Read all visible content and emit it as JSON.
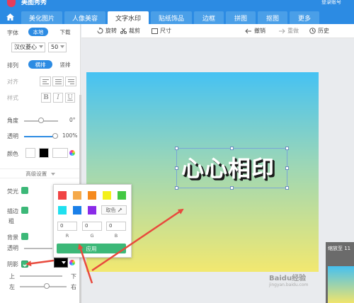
{
  "app": {
    "title": "美图秀秀",
    "login": "登录账号"
  },
  "tabs": [
    {
      "label": "美化图片"
    },
    {
      "label": "人像美容"
    },
    {
      "label": "文字水印"
    },
    {
      "label": "贴纸饰品"
    },
    {
      "label": "边框"
    },
    {
      "label": "拼图"
    },
    {
      "label": "抠图"
    },
    {
      "label": "更多"
    }
  ],
  "toolbar": {
    "rotate": "旋转",
    "crop": "裁剪",
    "size": "尺寸",
    "undo": "撤销",
    "redo": "重做",
    "history": "历史"
  },
  "left_panel": {
    "font_label": "字体",
    "font_local": "本地",
    "font_download": "下载",
    "font_name": "汉仪菱心",
    "font_size": "50",
    "layout_label": "排列",
    "layout_horizontal": "横排",
    "layout_vertical": "竖排",
    "align_label": "对齐",
    "style_label": "样式",
    "style_b": "B",
    "style_i": "I",
    "style_u": "U",
    "angle_label": "角度",
    "angle_value": "0°",
    "opacity_label": "透明",
    "opacity_value": "100%",
    "color_label": "颜色",
    "advanced": "高级设置",
    "glow_label": "荧光",
    "stroke_label": "描边",
    "stroke_thick": "粗",
    "bg_label": "背景",
    "bg_opacity": "透明",
    "shadow_label": "阴影",
    "shadow_top": "上",
    "shadow_bottom": "下",
    "shadow_left": "左",
    "shadow_right": "右"
  },
  "popup": {
    "pick_label": "取色",
    "r_value": "0",
    "g_value": "0",
    "b_value": "0",
    "r_label": "R",
    "g_label": "G",
    "b_label": "B",
    "apply": "应用",
    "colors": [
      "#f04343",
      "#f5a94a",
      "#f58a1e",
      "#f3f01c",
      "#43c843",
      "#1fe0ef",
      "#1a7fe8",
      "#8a2be8"
    ]
  },
  "canvas": {
    "text": "心心相印"
  },
  "preview": {
    "label": "缩放至 11"
  },
  "watermark": {
    "brand": "Baidu经验",
    "url": "jingyan.baidu.com"
  },
  "colors": {
    "accent": "#2c8be3",
    "green": "#3cb878",
    "arrow": "#e84a3d"
  }
}
